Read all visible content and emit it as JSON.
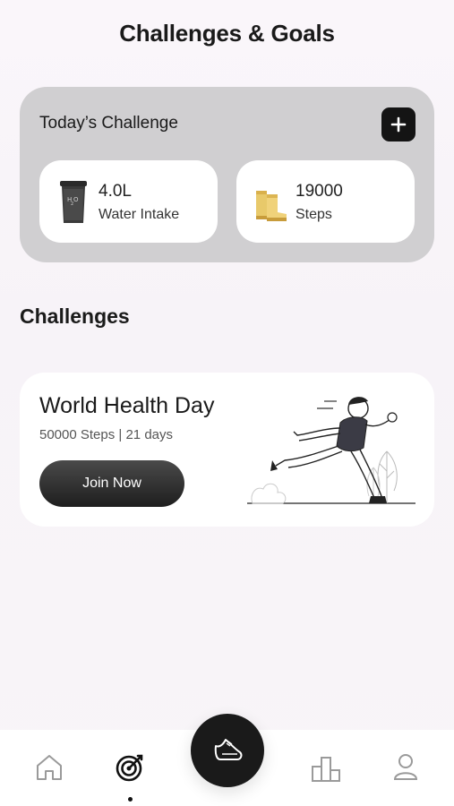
{
  "header": {
    "title": "Challenges & Goals"
  },
  "today": {
    "label": "Today’s Challenge",
    "add_icon": "plus-icon",
    "items": [
      {
        "value": "4.0L",
        "caption": "Water Intake",
        "icon": "water-bottle-icon"
      },
      {
        "value": "19000",
        "caption": "Steps",
        "icon": "boots-icon"
      }
    ]
  },
  "challenges": {
    "heading": "Challenges",
    "cards": [
      {
        "title": "World Health Day",
        "meta": "50000 Steps | 21 days",
        "button": "Join Now",
        "illustration": "runner-illustration"
      }
    ]
  },
  "nav": {
    "items": [
      "home-icon",
      "target-icon",
      "shoe-icon",
      "leaderboard-icon",
      "profile-icon"
    ],
    "active": "target-icon"
  },
  "colors": {
    "accent": "#1a1a1a",
    "card_gray": "#d0cfd1",
    "boot_yellow": "#e8c96a"
  }
}
